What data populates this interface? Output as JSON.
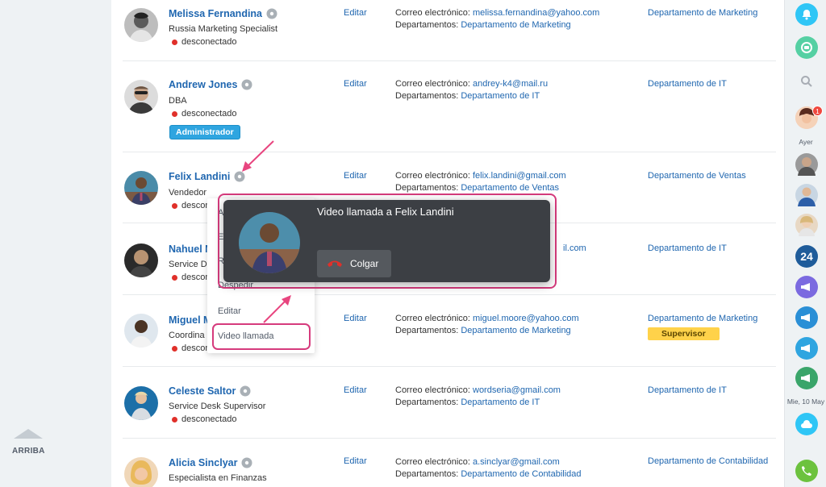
{
  "left_rail": {
    "up_label": "ARRIBA"
  },
  "labels": {
    "edit": "Editar",
    "email_prefix": "Correo electrónico:",
    "depts_prefix": "Departamentos:"
  },
  "employees": [
    {
      "name": "Melissa Fernandina",
      "position": "Russia Marketing Specialist",
      "status": "desconectado",
      "email": "melissa.fernandina@yahoo.com",
      "department": "Departamento de Marketing"
    },
    {
      "name": "Andrew Jones",
      "position": "DBA",
      "status": "desconectado",
      "badge": "Administrador",
      "email": "andrey-k4@mail.ru",
      "department": "Departamento de IT"
    },
    {
      "name": "Felix Landini",
      "position": "Vendedor",
      "status": "desconectado",
      "email": "felix.landini@gmail.com",
      "department": "Departamento de Ventas"
    },
    {
      "name": "Nahuel M",
      "position": "Service D",
      "status": "descon",
      "email_tail": "il.com",
      "department": "Departamento de IT"
    },
    {
      "name": "Miguel M",
      "position": "Coordina",
      "status": "descon",
      "email": "miguel.moore@yahoo.com",
      "department": "Departamento de Marketing",
      "dept_badge": "Supervisor"
    },
    {
      "name": "Celeste Saltor",
      "position": "Service Desk Supervisor",
      "status": "desconectado",
      "email": "wordseria@gmail.com",
      "department": "Departamento de IT"
    },
    {
      "name": "Alicia Sinclyar",
      "position": "Especialista en Finanzas",
      "email": "a.sinclyar@gmail.com",
      "department": "Departamento de Contabilidad"
    }
  ],
  "context_menu": {
    "items": [
      "A",
      "E",
      "R",
      "Despedir",
      "Editar",
      "Video llamada"
    ]
  },
  "call_popup": {
    "title": "Video llamada a Felix Landini",
    "hangup_label": "Colgar",
    "hangup_color": "#e0302a"
  },
  "right_bar": {
    "label_yesterday": "Ayer",
    "label_date": "Mie, 10 May",
    "chat_count": "1",
    "b24_label": "24",
    "accent": "#2fc6f6",
    "green": "#55d0a3",
    "phone_green": "#6cc23e"
  }
}
